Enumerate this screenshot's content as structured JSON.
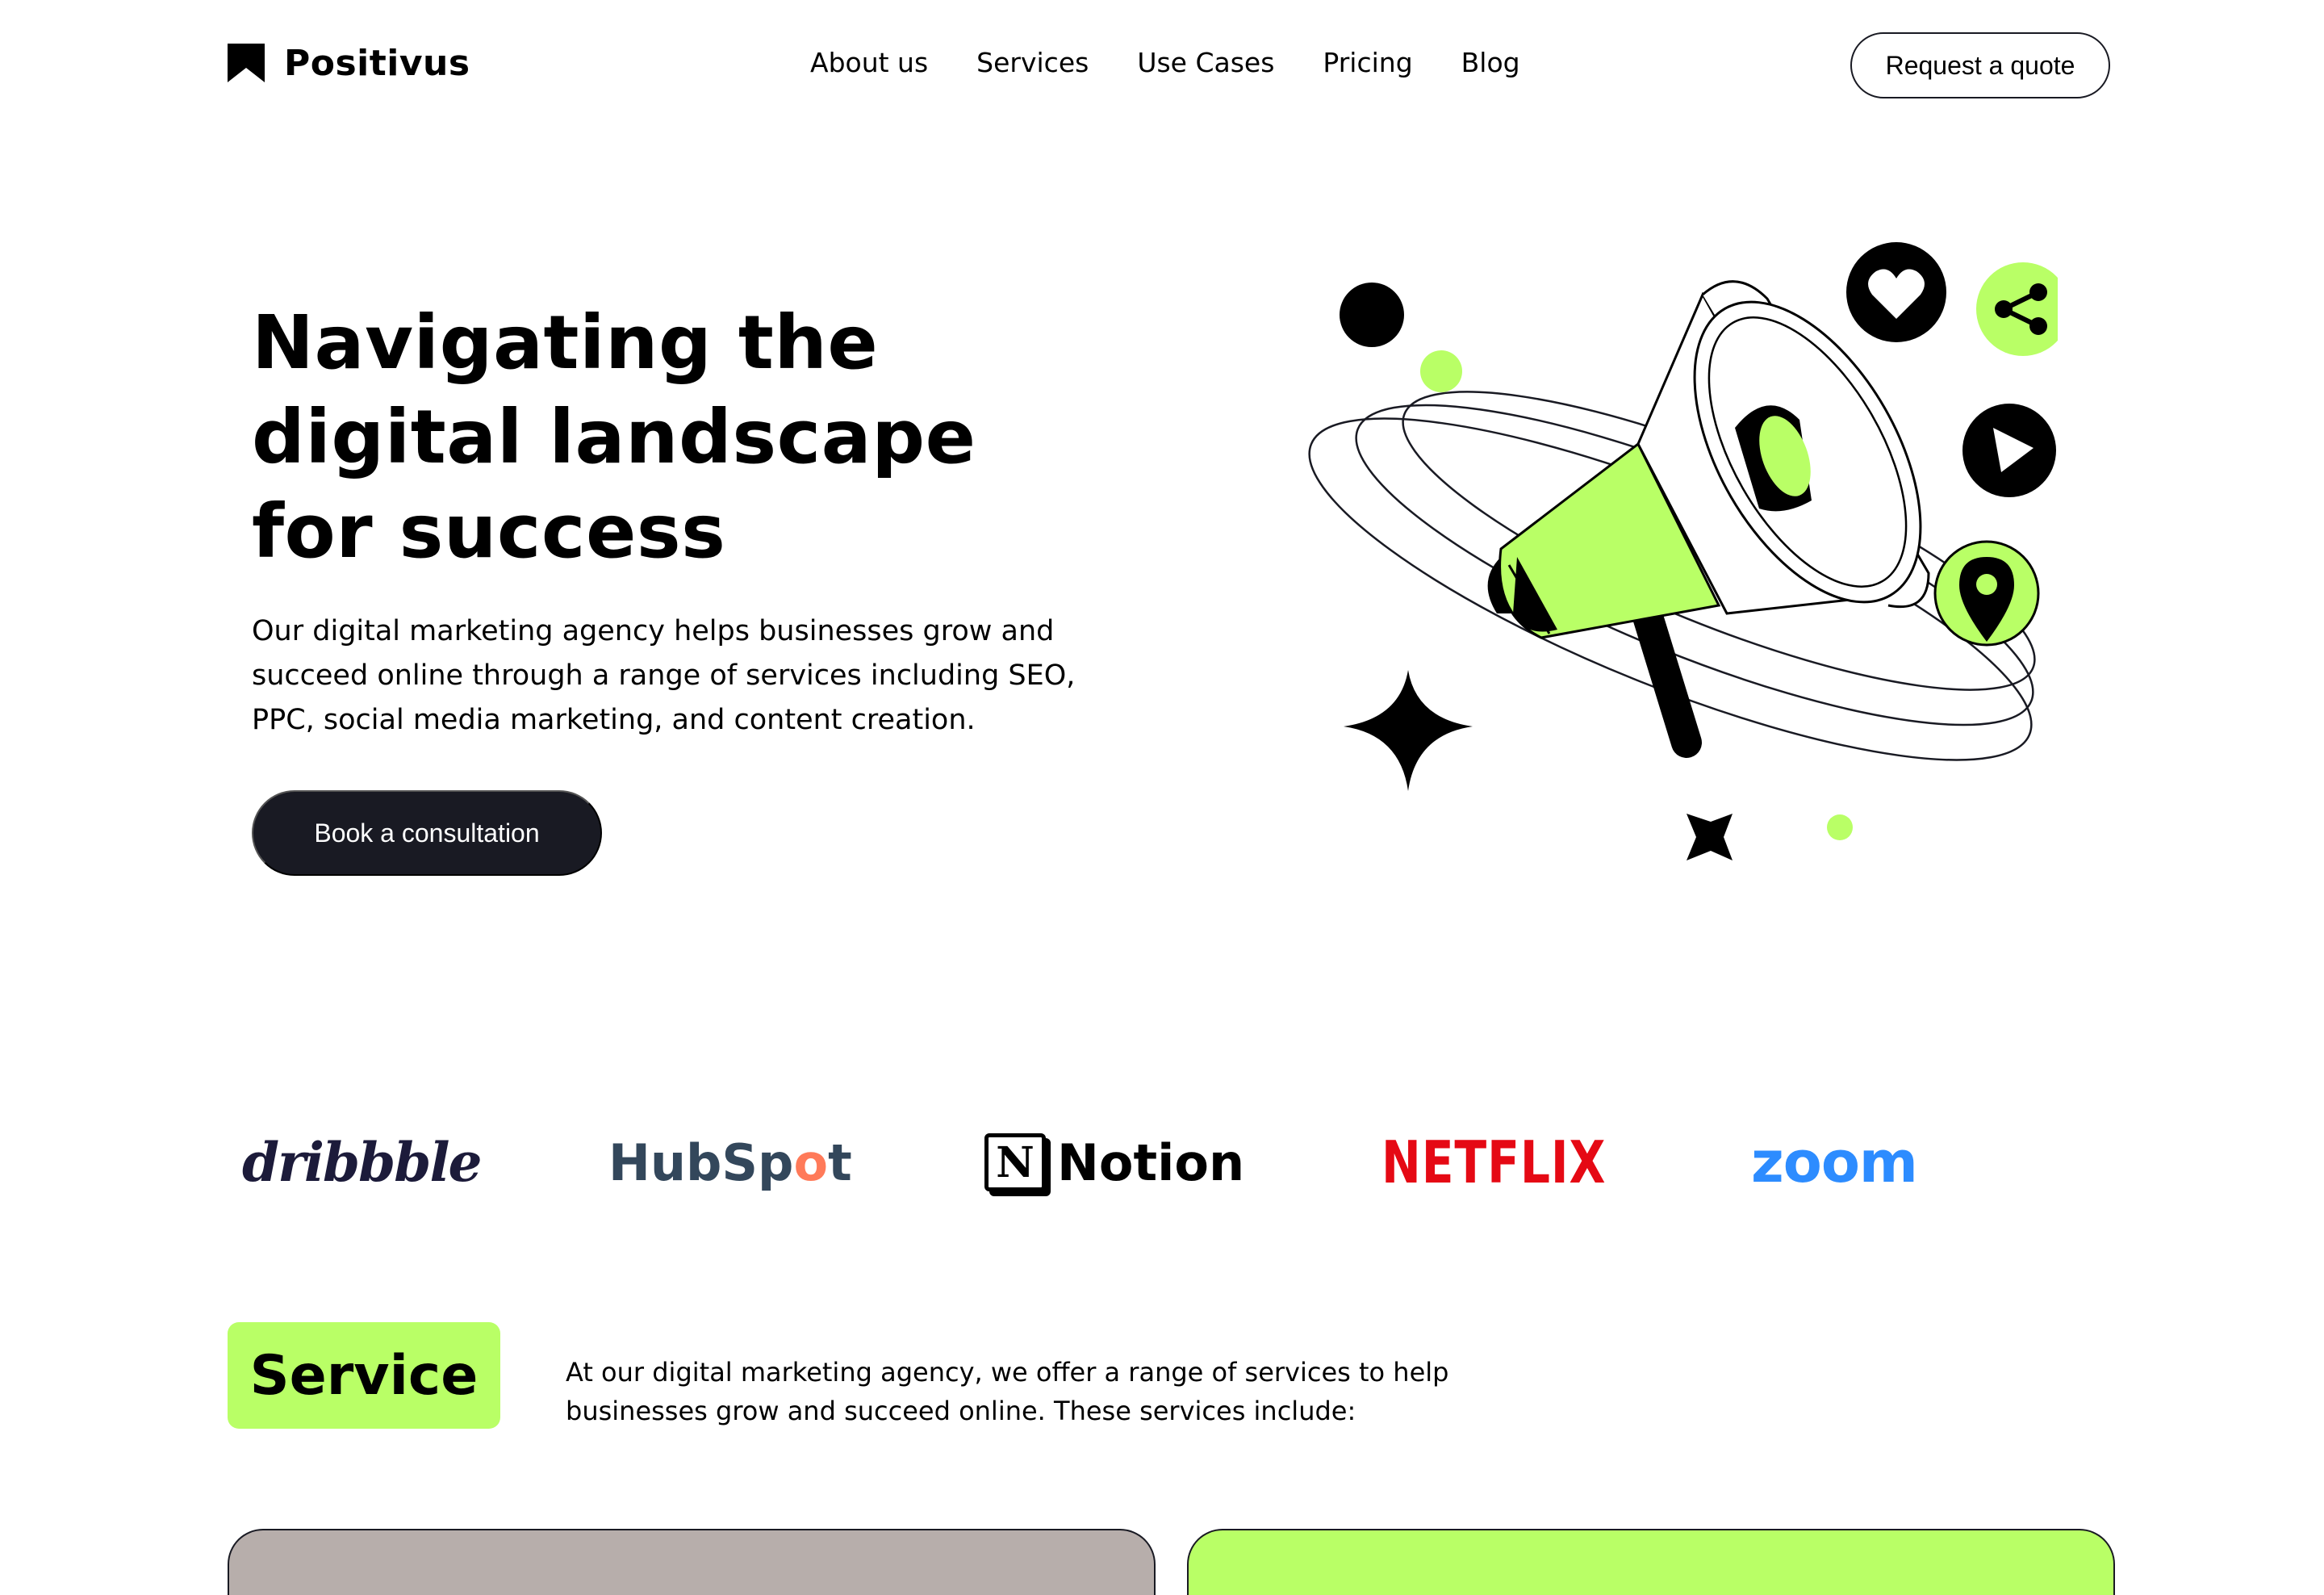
{
  "brand": {
    "name": "Positivus"
  },
  "nav": {
    "items": [
      {
        "label": "About us"
      },
      {
        "label": "Services"
      },
      {
        "label": "Use Cases"
      },
      {
        "label": "Pricing"
      },
      {
        "label": "Blog"
      }
    ],
    "cta_label": "Request a quote"
  },
  "hero": {
    "title": "Navigating the digital landscape for success",
    "subtitle": "Our digital marketing agency helps businesses grow and succeed online through a range of services including SEO, PPC, social media marketing, and content creation.",
    "button_label": "Book a consultation"
  },
  "logos": {
    "dribbble": "dribbble",
    "hubspot_a": "HubSp",
    "hubspot_o": "o",
    "hubspot_b": "t",
    "notion_mark": "N",
    "notion": "Notion",
    "netflix": "NETFLIX",
    "zoom": "zoom"
  },
  "services": {
    "tag": "Service",
    "description": "At our digital marketing agency, we offer a range of services to help businesses grow and succeed online. These services include:"
  },
  "colors": {
    "accent_green": "#b9ff66",
    "dark": "#191a23",
    "card_grey": "#b7aeab"
  },
  "icons": [
    "bookmark-logo-icon",
    "megaphone-icon",
    "heart-icon",
    "share-icon",
    "play-icon",
    "location-pin-icon",
    "sparkle-star-icon"
  ]
}
